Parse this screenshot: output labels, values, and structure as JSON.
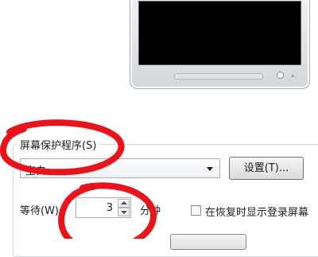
{
  "screensaver": {
    "group_label": "屏幕保护程序(S)",
    "selected": "空白",
    "settings_button": "设置(T)...",
    "wait_label": "等待(W):",
    "wait_value": "3",
    "wait_unit": "分钟",
    "resume_checkbox_label": "在恢复时显示登录屏幕",
    "resume_checked": false
  },
  "annotations": {
    "color": "#e8141b"
  },
  "colors": {
    "screen": "#000000",
    "group_border": "#d5dae1"
  }
}
